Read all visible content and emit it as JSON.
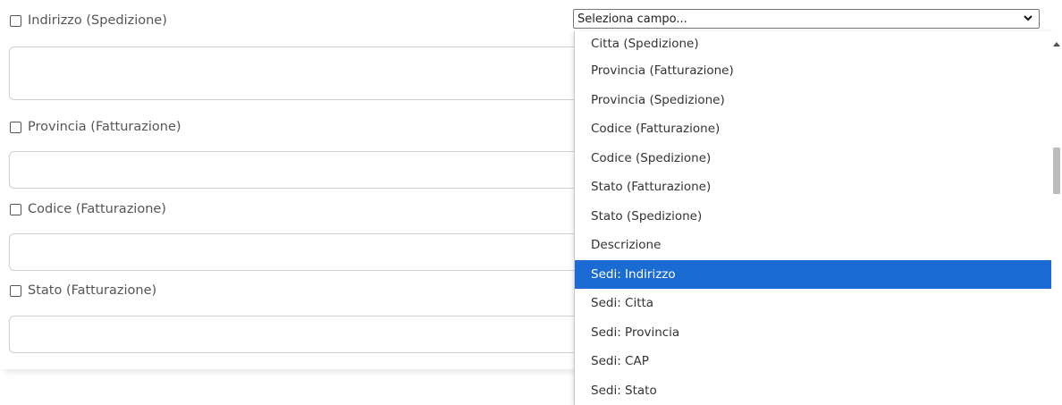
{
  "fields": [
    {
      "label": "Indirizzo (Spedizione)"
    },
    {
      "label": "Provincia (Fatturazione)"
    },
    {
      "label": "Codice (Fatturazione)"
    },
    {
      "label": "Stato (Fatturazione)"
    }
  ],
  "select": {
    "value": "Seleziona campo...",
    "options": [
      "Citta (Spedizione)",
      "Provincia (Fatturazione)",
      "Provincia (Spedizione)",
      "Codice (Fatturazione)",
      "Codice (Spedizione)",
      "Stato (Fatturazione)",
      "Stato (Spedizione)",
      "Descrizione",
      "Sedi: Indirizzo",
      "Sedi: Citta",
      "Sedi: Provincia",
      "Sedi: CAP",
      "Sedi: Stato"
    ],
    "highlighted": "Sedi: Indirizzo"
  },
  "colors": {
    "highlight": "#1a6bd4",
    "text": "#555555"
  }
}
